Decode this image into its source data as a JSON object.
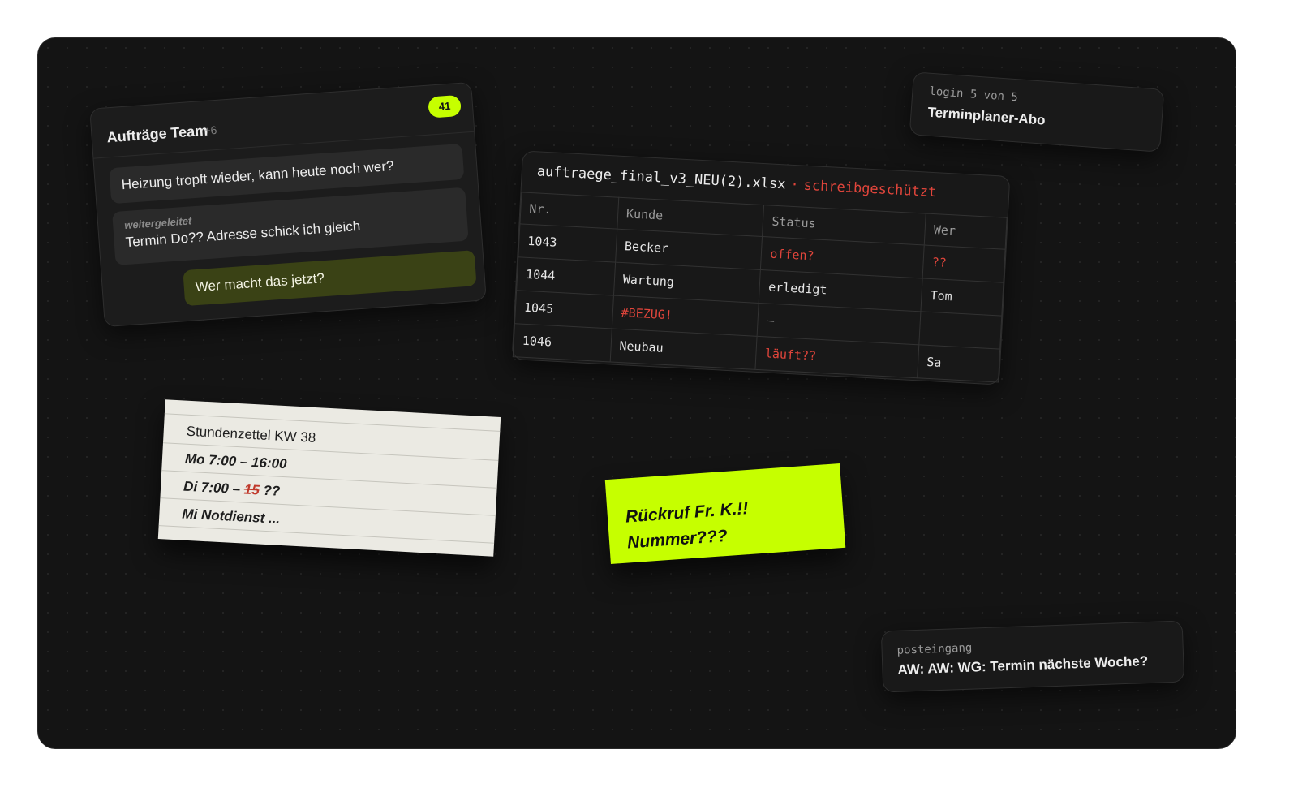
{
  "chat": {
    "title": "Aufträge Team",
    "extra": "+6",
    "count": "41",
    "messages": [
      {
        "text": "Heizung tropft wieder, kann heute noch wer?"
      },
      {
        "label": "weitergeleitet",
        "text": "Termin Do?? Adresse schick ich gleich"
      },
      {
        "text": "Wer macht das jetzt?"
      }
    ]
  },
  "login": {
    "line1": "login 5 von 5",
    "line2": "Terminplaner-Abo"
  },
  "sheet": {
    "filename": "auftraege_final_v3_NEU(2).xlsx",
    "separator": "·",
    "status": "schreibgeschützt",
    "columns": [
      "Nr.",
      "Kunde",
      "Status",
      "Wer"
    ],
    "rows": [
      [
        "1043",
        "Becker",
        "offen?",
        "??"
      ],
      [
        "1044",
        "Wartung",
        "erledigt",
        "Tom"
      ],
      [
        "1045",
        "#BEZUG!",
        "–",
        ""
      ],
      [
        "1046",
        "Neubau",
        "läuft??",
        "Sa"
      ]
    ],
    "error_color": "#e0453b"
  },
  "timesheet": {
    "title": "Stundenzettel KW 38",
    "line1": "Mo 7:00 – 16:00",
    "line2_prefix": "Di 7:00 –",
    "line2_struck": "15",
    "line2_suffix": "??",
    "line3": "Mi Notdienst ..."
  },
  "sticky": {
    "line1": "Rückruf Fr. K.!!",
    "line2": "Nummer???",
    "color": "#c6ff00"
  },
  "inbox": {
    "label": "posteingang",
    "subject": "AW: AW: WG: Termin nächste Woche?"
  }
}
